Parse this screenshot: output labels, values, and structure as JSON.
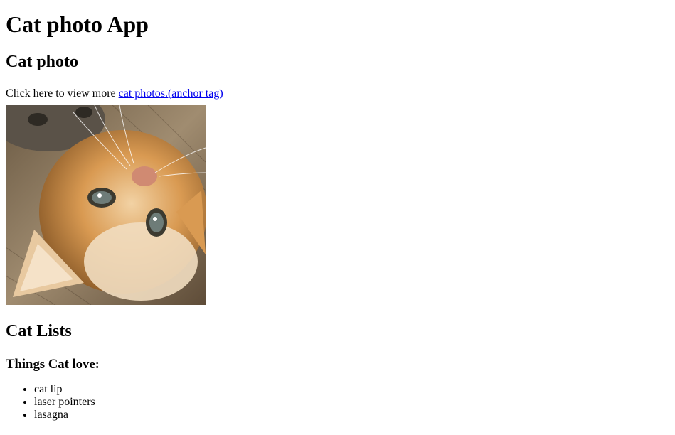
{
  "page": {
    "title": "Cat photo App",
    "photo_section": {
      "heading": "Cat photo",
      "intro_text": "Click here to view more ",
      "link_text": "cat photos.(anchor tag)"
    },
    "lists_section": {
      "heading": "Cat Lists",
      "subheading": "Things Cat love:",
      "items": [
        "cat lip",
        "laser pointers",
        "lasagna"
      ]
    }
  }
}
